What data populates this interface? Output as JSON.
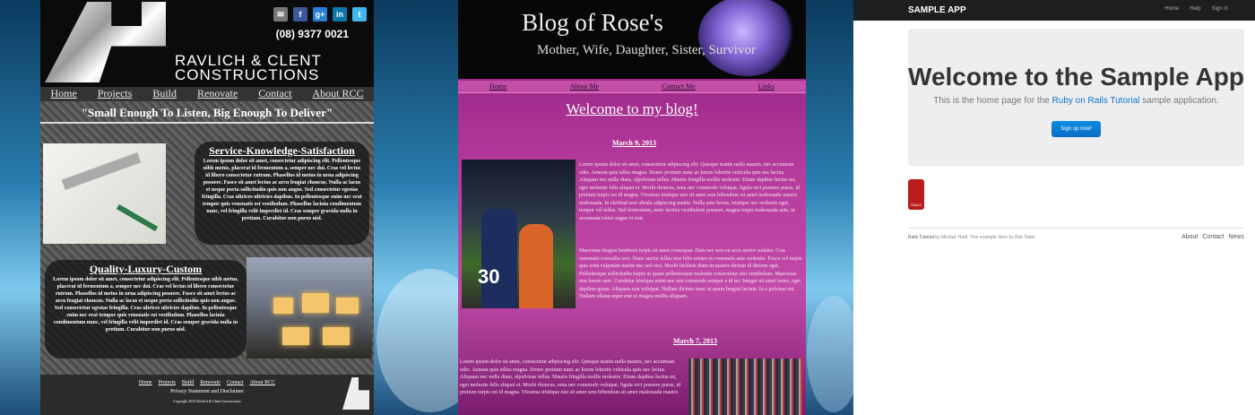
{
  "site1": {
    "phone": "(08) 9377 0021",
    "brand_line1": "RAVLICH & CLENT",
    "brand_line2": "CONSTRUCTIONS",
    "social": [
      {
        "icon": "email-icon",
        "glyph": "✉",
        "color": "#777777"
      },
      {
        "icon": "facebook-icon",
        "glyph": "f",
        "color": "#3b5998"
      },
      {
        "icon": "googleplus-icon",
        "glyph": "g+",
        "color": "#2a7fd4"
      },
      {
        "icon": "linkedin-icon",
        "glyph": "in",
        "color": "#0e76a8"
      },
      {
        "icon": "twitter-icon",
        "glyph": "t",
        "color": "#3fb8ee"
      }
    ],
    "nav": [
      "Home",
      "Projects",
      "Build",
      "Renovate",
      "Contact",
      "About RCC"
    ],
    "tagline": "\"Small Enough To Listen, Big Enough To Deliver\"",
    "section1_title": "Service-Knowledge-Satisfaction",
    "section1_text": "Lorem ipsum dolor sit amet, consectetur adipiscing elit. Pellentesque nibh metus, placerat id fermentum a, semper nec dui. Cras vel lectus id libero consectetur rutrum. Phasellus id metus in urna adipiscing posuere. Fusce sit amet lectus ac arcu feugiat rhoncus. Nulla ac lacus et neque porta sollicitudin quis non augue. Sed consectetur egestas fringilla. Cras ultrices ultricies dapibus. In pellentesque enim nec erat tempor quis venenatis est vestibulum. Phasellus lacinia condimentum nunc, vel fringilla velit imperdiet id. Cras semper gravida nulla in pretium. Curabitur non purus nisl.",
    "section2_title": "Quality-Luxury-Custom",
    "section2_text": "Lorem ipsum dolor sit amet, consectetur adipiscing elit. Pellentesque nibh metus, placerat id fermentum a, semper nec dui. Cras vel lectus id libero consectetur rutrum. Phasellus id metus in urna adipiscing posuere. Fusce sit amet lectus ac arcu feugiat rhoncus. Nulla ac lacus et neque porta sollicitudin quis non augue. Sed consectetur egestas fringilla. Cras ultrices ultricies dapibus. In pellentesque enim nec erat tempor quis venenatis est vestibulum. Phasellus lacinia condimentum nunc, vel fringilla velit imperdiet id. Cras semper gravida nulla in pretium. Curabitur non purus nisl.",
    "footer_links": [
      "Home",
      "Projects",
      "Build",
      "Renovate",
      "Contact",
      "About RCC"
    ],
    "privacy": "Privacy Statement and Disclaimer",
    "copyright": "Copyright 2013 Ravlich & Clent Constructions"
  },
  "site2": {
    "title": "Blog of Rose's",
    "subtitle": "Mother, Wife, Daughter, Sister, Survivor",
    "nav": [
      "Home",
      "About Me",
      "Contact Me",
      "Links"
    ],
    "welcome": "Welcome to my blog!",
    "post1_date": "March 9, 2013",
    "post1_text": "Lorem ipsum dolor sit amet, consectetur adipiscing elit. Quisque mattis nulla mauris, nec accumsan odio. Aenean quis tellus magna. Donec pretium nunc ac lorem lobortis vehicula quis nec lectus. Aliquam nec nulla diam, ulpulvinar tellus. Mauris fringilla mollis molestie. Etiam dapibus luctus mi, eget molestie felis aliquet et. Morbi rhoncus, urna nec commodo volutpat, ligula orci posuere purus, id pretium turpis est id magna. Vivamus tristique nisi sit amet sem bibendum sit amet malesuada mauris malesuada. In eleifend erat ultrala adipiscing mattis. Nulla ante lectus, tristique nec molestie eget, tempor vel tellus. Sed fermentum, nunc lacinia vestibulum posuere, magna turpis malesuada ante, ut accumsan tortor augue et erat.",
    "post1_text2": "Maecenas feugiat hendrerit turpis sit amet consequat. Duis nec sem eu arcu auctor sodales. Cras venenatis convallis orci. Nunc auctor tellus non felis ornare eu venenatis ante molestie. Fusce vel turpis quis urna vulputate mattis nec sed orci. Morbi facilisis diam in mauris dictum id dictum eget. Pellentesque sollicitudin turpis ut quam pellentesque molestie consectetur nisi vestibulum. Maecenas non lorem ante. Curabitur tristique enim nec nisi commodo semper a id mi. Integer sit amet tortor, eget dapibus quam. Aliquam erat volutpat. Nullam dictum nunc ut quam feugiat lacinia. In a pulvinar mi. Nullam ullamcorper erat ut magna mollis aliquam.",
    "post2_date": "March 7, 2013",
    "post2_text": "Lorem ipsum dolor sit amet, consectetur adipiscing elit. Quisque mattis nulla mauris, nec accumsan odio. Aenean quis tellus magna. Donec pretium nunc ac lorem lobortis vehicula quis nec lectus. Aliquam nec nulla diam, ulpulvinar tellus. Mauris fringilla mollis molestie. Etiam dapibus luctus mi, eget molestie felis aliquet et. Morbi rhoncus, urna nec commodo volutpat, ligula orci posuere purus, id pretium turpis est id magna. Vivamus tristique nisi sit amet sem bibendum sit amet malesuada mauris"
  },
  "site3": {
    "app_name": "SAMPLE APP",
    "topnav": [
      "Home",
      "Help",
      "Sign in"
    ],
    "hero_title": "Welcome to the Sample App",
    "hero_text_before": "This is the home page for the ",
    "hero_link": "Ruby on Rails Tutorial",
    "hero_text_after": " sample application.",
    "signup": "Sign up now!",
    "rails_logo": "RAILS",
    "footer_link": "Rails Tutorial",
    "footer_credit": " by Michael Hartl. This example done by Bob Tabor",
    "footer_nav": [
      "About",
      "Contact",
      "News"
    ]
  }
}
